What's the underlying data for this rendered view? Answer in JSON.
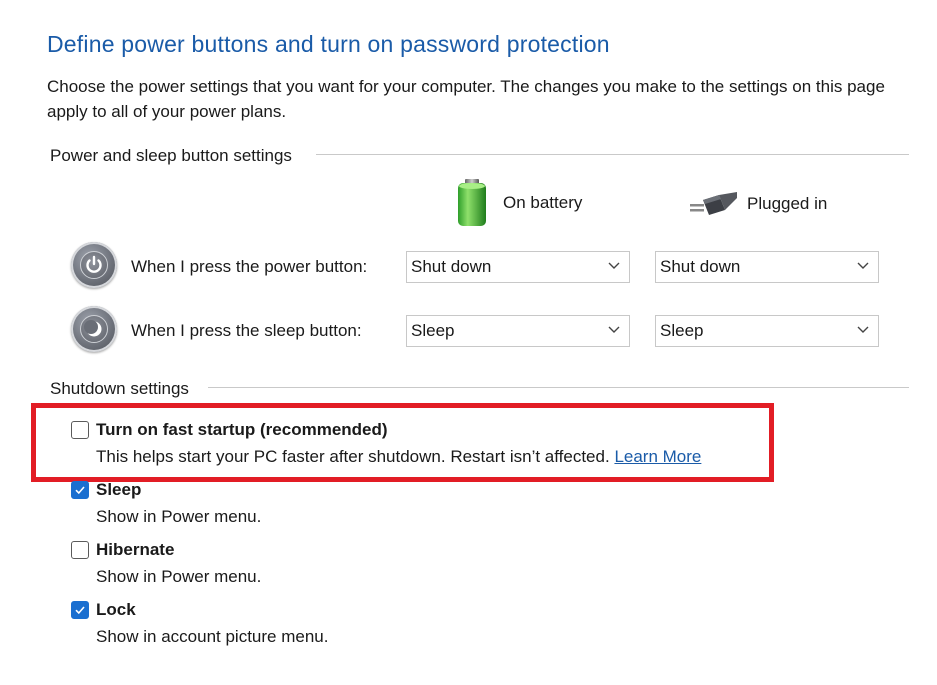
{
  "page": {
    "title": "Define power buttons and turn on password protection",
    "intro": "Choose the power settings that you want for your computer. The changes you make to the settings on this page apply to all of your power plans."
  },
  "power_group": {
    "title": "Power and sleep button settings",
    "columns": {
      "battery": {
        "label": "On battery",
        "icon": "battery-icon"
      },
      "plugged": {
        "label": "Plugged in",
        "icon": "power-plug-icon"
      }
    },
    "rows": [
      {
        "label": "When I press the power button:",
        "icon": "power-button-icon",
        "battery_value": "Shut down",
        "plugged_value": "Shut down"
      },
      {
        "label": "When I press the sleep button:",
        "icon": "sleep-button-icon",
        "battery_value": "Sleep",
        "plugged_value": "Sleep"
      }
    ]
  },
  "shutdown_group": {
    "title": "Shutdown settings",
    "options": [
      {
        "title": "Turn on fast startup (recommended)",
        "desc": "This helps start your PC faster after shutdown. Restart isn’t affected.",
        "link": "Learn More",
        "checked": false
      },
      {
        "title": "Sleep",
        "desc": "Show in Power menu.",
        "checked": true
      },
      {
        "title": "Hibernate",
        "desc": "Show in Power menu.",
        "checked": false
      },
      {
        "title": "Lock",
        "desc": "Show in account picture menu.",
        "checked": true
      }
    ]
  },
  "colors": {
    "title_blue": "#1a5ba8",
    "checkbox_blue": "#1a6fd0",
    "highlight_red": "#e21d25"
  }
}
